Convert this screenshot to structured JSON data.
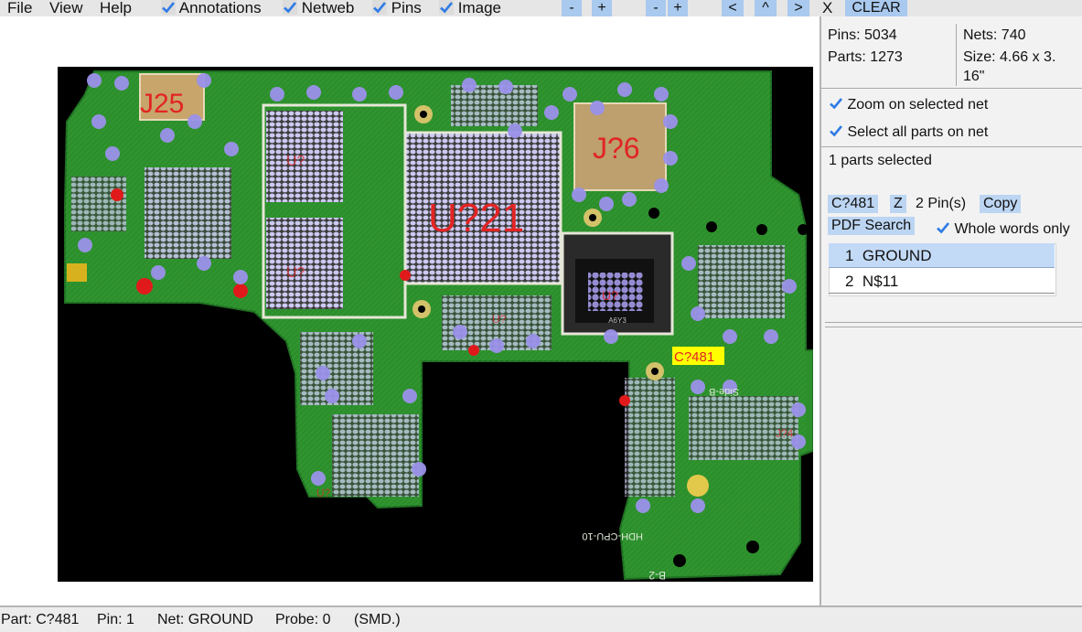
{
  "menu": {
    "file": "File",
    "view": "View",
    "help": "Help",
    "toggles": [
      {
        "label": "Annotations",
        "checked": true
      },
      {
        "label": "Netweb",
        "checked": true
      },
      {
        "label": "Pins",
        "checked": true
      },
      {
        "label": "Image",
        "checked": true
      }
    ],
    "zoom_out_1": "-",
    "zoom_in_1": "+",
    "zoom_out_2": "-",
    "zoom_in_2": "+",
    "nav_left": "<",
    "nav_up": "^",
    "nav_right": ">",
    "close": "X",
    "clear": "CLEAR"
  },
  "board": {
    "parts_big": [
      "J25",
      "J?6",
      "U?21"
    ],
    "parts_small": [
      "U?",
      "U?",
      "U?",
      "U?",
      "J?4",
      "U?"
    ],
    "selected_part": "C?481",
    "silkscreen": [
      "HDH-CPU-10",
      "Side-B",
      "B-2"
    ],
    "chip_marking": "A6Y3",
    "pin_label": "GROUND",
    "colors": {
      "pcb": "#2c8f2c",
      "pcb_dark": "#1f6e22",
      "pin_marker": "#9b92ea",
      "part_label": "#e22424",
      "selected_bg": "#ffff00"
    }
  },
  "info": {
    "pins": "Pins: 5034",
    "parts": "Parts: 1273",
    "nets": "Nets: 740",
    "size_line1": "Size: 4.66 x 3.",
    "size_line2": "16\""
  },
  "options": {
    "zoom_on_net": "Zoom on selected net",
    "select_all_parts": "Select all parts on net"
  },
  "selection": {
    "count_text": "1 parts selected",
    "part_name": "C?481",
    "z_button": "Z",
    "pin_count": "2 Pin(s)",
    "copy_button": "Copy",
    "pdf_search": "PDF Search",
    "whole_words": "Whole words only",
    "pins": [
      {
        "num": "1",
        "net": "GROUND",
        "selected": true
      },
      {
        "num": "2",
        "net": "N$11",
        "selected": false
      }
    ]
  },
  "status": {
    "part": "Part: C?481",
    "pin": "Pin: 1",
    "net": "Net: GROUND",
    "probe": "Probe: 0",
    "type": "(SMD.)"
  },
  "theme": {
    "accent": "#2f7be6",
    "button_bg": "#a9c9ee",
    "selected_row": "#c3daf7"
  }
}
